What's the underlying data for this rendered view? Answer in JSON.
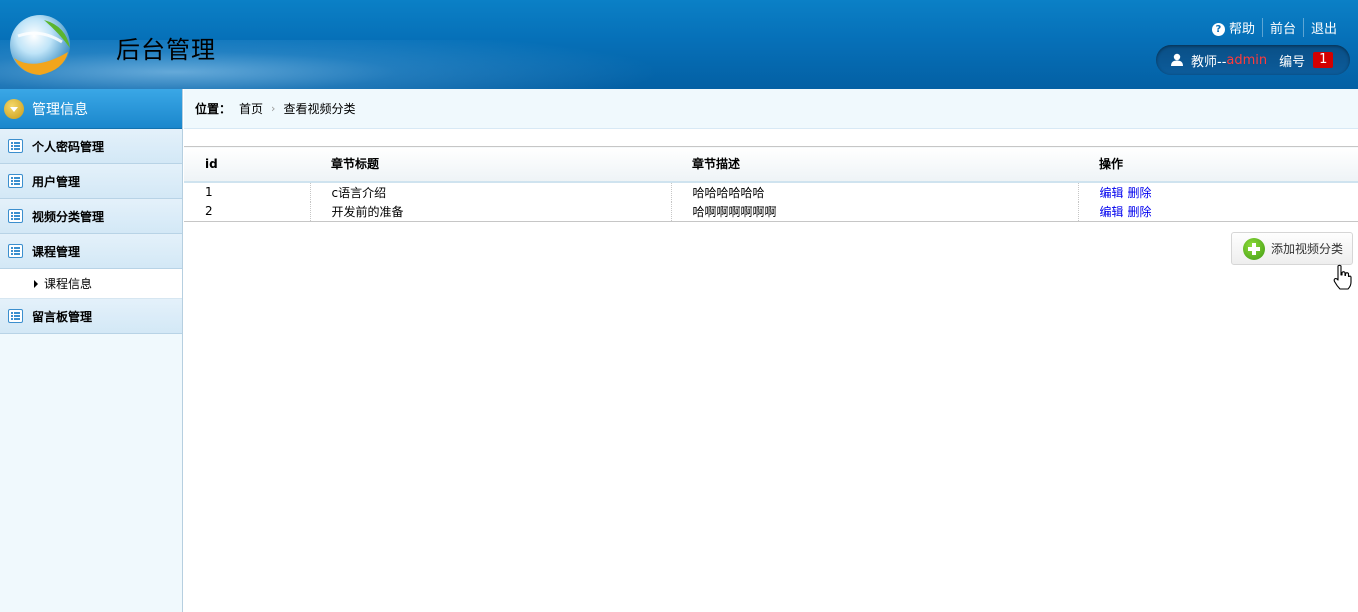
{
  "header": {
    "title": "后台管理",
    "links": {
      "help": "帮助",
      "front": "前台",
      "logout": "退出"
    },
    "user": {
      "role": "教师--",
      "name": "admin",
      "id_label": "编号",
      "id_value": "1"
    }
  },
  "sidebar": {
    "title": "管理信息",
    "items": [
      {
        "label": "个人密码管理"
      },
      {
        "label": "用户管理"
      },
      {
        "label": "视频分类管理"
      },
      {
        "label": "课程管理"
      }
    ],
    "sub_item": "课程信息",
    "last_item": "留言板管理"
  },
  "breadcrumb": {
    "prefix": "位置：",
    "home": "首页",
    "current": "查看视频分类"
  },
  "table": {
    "headers": [
      "id",
      "章节标题",
      "章节描述",
      "操作"
    ],
    "rows": [
      {
        "id": "1",
        "title": "c语言介绍",
        "desc": "哈哈哈哈哈哈",
        "edit": "编辑",
        "del": "删除"
      },
      {
        "id": "2",
        "title": "开发前的准备",
        "desc": "哈啊啊啊啊啊啊",
        "edit": "编辑",
        "del": "删除"
      }
    ]
  },
  "add_button": "添加视频分类",
  "colors": {
    "header_blue": "#0670b8",
    "link_blue": "#0000ee",
    "accent_red": "#d40000"
  },
  "icons": {
    "help": "question-icon",
    "user": "user-icon",
    "toggle": "chevron-down-icon",
    "list": "list-icon",
    "add": "plus-icon"
  }
}
